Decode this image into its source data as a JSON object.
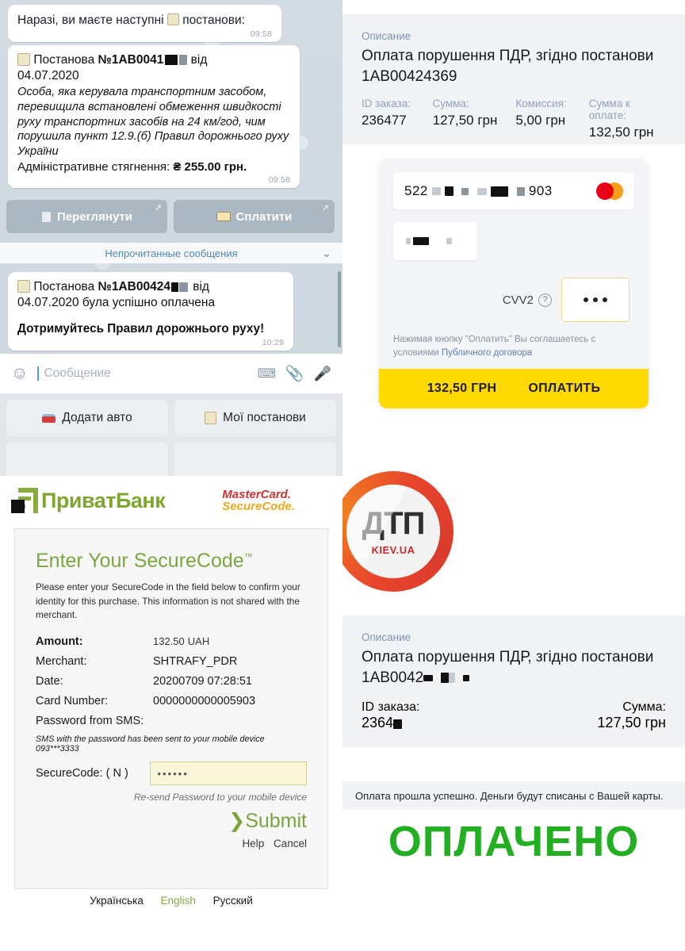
{
  "telegram": {
    "msg1": {
      "text_before": "Наразі, ви маєте наступні",
      "icon": "clipboard-emoji",
      "text_after": "постанови:",
      "time": "09:58"
    },
    "msg2": {
      "icon": "clipboard-emoji",
      "header_prefix": "Постанова ",
      "header_number": "№1AB0041",
      "header_suffix": " від",
      "header_date": "04.07.2020",
      "body": "Особа, яка керувала транспортним засобом, перевищила встановлені обмеження швидкості руху транспортних засобів на 24 км/год, чим порушила пункт 12.9.(б) Правил дорожнього руху України",
      "penalty_label": "Адміністративне стягнення:",
      "penalty_value": "₴ 255.00 грн.",
      "time": "09:58"
    },
    "inline_buttons": [
      {
        "label": "Переглянути",
        "icon": "page-emoji"
      },
      {
        "label": "Сплатити",
        "icon": "credit-card-emoji"
      }
    ],
    "unread_divider": "Непрочитанные сообщения",
    "msg3": {
      "icon": "clipboard-emoji",
      "line1_prefix": "Постанова ",
      "line1_number": "№1AB00424",
      "line1_suffix": " від",
      "line1_date": "04.07.2020 була успішно оплачена",
      "line2": "Дотримуйтесь Правил дорожнього руху!",
      "time": "10:29"
    },
    "composer": {
      "placeholder": "Сообщение",
      "emoji_icon": "smiley-icon",
      "keyboard_icon": "keyboard-icon",
      "attach_icon": "paperclip-icon",
      "voice_icon": "microphone-icon"
    },
    "keyboard_buttons": [
      {
        "label": "Додати авто",
        "icon": "car-emoji"
      },
      {
        "label": "Мої постанови",
        "icon": "clipboard-emoji"
      },
      {
        "label": "",
        "icon": ""
      },
      {
        "label": "",
        "icon": ""
      }
    ]
  },
  "order_top": {
    "caption": "Описание",
    "title": "Оплата порушення ПДР, згідно постанови 1AB00424369",
    "fields": [
      {
        "label": "ID заказа:",
        "value": "236477"
      },
      {
        "label": "Сумма:",
        "value": "127,50 грн"
      },
      {
        "label": "Комиссия:",
        "value": "5,00 грн"
      },
      {
        "label": "Сумма к оплате:",
        "value": "132,50 грн"
      }
    ]
  },
  "paycard": {
    "card_prefix": "522",
    "card_suffix": "903",
    "brand_icon": "mastercard-icon",
    "expiry_value": "",
    "cvv_label": "CVV2",
    "help_icon": "question-icon",
    "cvv_value": "•••",
    "agreement_prefix": "Нажимая кнопку \"Оплатить\" Вы соглашаетесь с условиями ",
    "agreement_link": "Публичного договора",
    "pay_amount": "132,50 ГРН",
    "pay_label": "ОПЛАТИТЬ",
    "pay_color": "#ffd900"
  },
  "dtp_logo": {
    "title": "ДТП",
    "subtitle": "KIEV.UA",
    "ring_color": "#e8452c"
  },
  "privatbank": {
    "brand": "ПриватБанк",
    "brand_icon": "privatbank-logo-icon",
    "brand_color": "#7fa72f",
    "mastercard_line1": "MasterCard.",
    "mastercard_line2": "SecureCode.",
    "heading": "Enter Your SecureCode",
    "heading_tm": "™",
    "intro": "Please enter your SecureCode in the field below to confirm your identity for this purchase. This information is not shared with the merchant.",
    "rows": [
      {
        "label": "Amount:",
        "value": "132.50",
        "unit": "UAH"
      },
      {
        "label": "Merchant:",
        "value": "SHTRAFY_PDR"
      },
      {
        "label": "Date:",
        "value": "20200709 07:28:51"
      },
      {
        "label": "Card Number:",
        "value": "0000000000005903"
      },
      {
        "label": "Password from SMS:",
        "value": ""
      }
    ],
    "sms_note": "SMS with the password has been sent to your mobile device 093***3333",
    "securecode_label": "SecureCode:  ( N )",
    "securecode_value": "••••••",
    "securecode_placeholder": "",
    "resend": "Re-send Password to your mobile device",
    "submit": "Submit",
    "submit_chevron": "❯",
    "help": "Help",
    "cancel": "Cancel",
    "languages": [
      {
        "label": "Українська",
        "active": false
      },
      {
        "label": "English",
        "active": true
      },
      {
        "label": "Русский",
        "active": false
      }
    ]
  },
  "order_bottom": {
    "caption": "Описание",
    "title_line1": "Оплата порушення ПДР, згідно постанови",
    "title_line2": "1AB0042",
    "id_label": "ID заказа:",
    "id_value": "2364",
    "sum_label": "Сумма:",
    "sum_value": "127,50 грн"
  },
  "result": {
    "bar_text": "Оплата прошла успешно. Деньги будут списаны с Вашей карты.",
    "paid_text": "ОПЛАЧЕНО",
    "paid_color": "#22b022"
  }
}
